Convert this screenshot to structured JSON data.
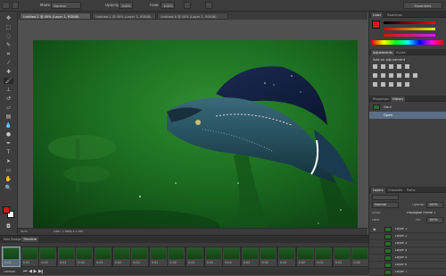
{
  "options_bar": {
    "mode_label": "Mode:",
    "mode_value": "Normal",
    "opacity_label": "Opacity:",
    "opacity_value": "100%",
    "flow_label": "Flow:",
    "flow_value": "100%",
    "workspace": "Essentials"
  },
  "doc_tabs": [
    "Untitled-1 @ 50% (Layer 1, RGB/8)",
    "Untitled-1 @ 50% (Layer 1, RGB/8)",
    "Untitled-6 @ 50% (Layer 1, RGB/8)"
  ],
  "status": {
    "zoom": "50%",
    "doc": "Doc: 1.98M/11.9M"
  },
  "panels": {
    "color_tabs": [
      "Color",
      "Swatches"
    ],
    "adjustments_tabs": [
      "Adjustments",
      "Styles"
    ],
    "add_adjustment": "Add an adjustment",
    "properties_tabs": [
      "Properties",
      "History"
    ],
    "history_items": [
      "Gaul",
      "Open"
    ],
    "layers_tabs": [
      "Layers",
      "Channels",
      "Paths"
    ],
    "blend_mode": "Normal",
    "opacity_label": "Opacity:",
    "opacity_value": "100%",
    "unify_label": "Unify:",
    "propagate_label": "Propagate Frame 1",
    "lock_label": "Lock:",
    "fill_label": "Fill:",
    "fill_value": "100%",
    "layers": [
      "Layer 1",
      "Layer 2",
      "Layer 3",
      "Layer 4",
      "Layer 5",
      "Layer 6",
      "Layer 7"
    ]
  },
  "timeline": {
    "tabs": [
      "Mini Bridge",
      "Timeline"
    ],
    "loop": "Forever",
    "frame_delay": "0.02",
    "frame_count": 20
  },
  "colors": {
    "foreground": "#d21919",
    "background": "#ffffff"
  }
}
